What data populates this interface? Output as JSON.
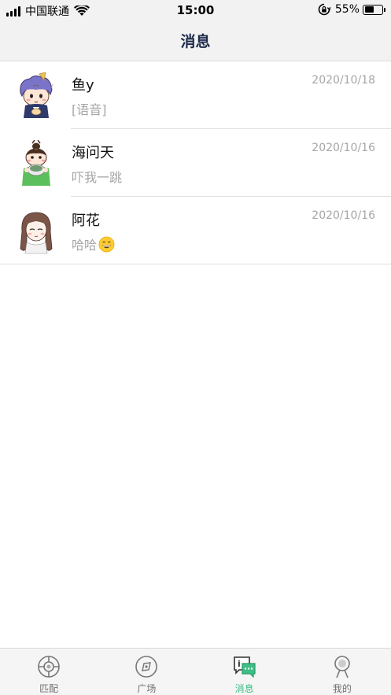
{
  "status_bar": {
    "carrier": "中国联通",
    "time": "15:00",
    "battery_percent": "55%",
    "battery_level": 0.55,
    "icons": [
      "signal-icon",
      "wifi-icon",
      "rotation-lock-icon",
      "battery-icon"
    ]
  },
  "header": {
    "title": "消息"
  },
  "conversations": [
    {
      "name": "鱼y",
      "date": "2020/10/18",
      "preview": "[语音]",
      "avatar": "purple-hair-boy-avatar"
    },
    {
      "name": "海问天",
      "date": "2020/10/16",
      "preview": "吓我一跳",
      "avatar": "bun-hair-girl-avatar"
    },
    {
      "name": "阿花",
      "date": "2020/10/16",
      "preview": "哈哈",
      "avatar": "long-hair-girl-avatar",
      "preview_emoji": "grinning-face-icon"
    }
  ],
  "tabs": [
    {
      "label": "匹配",
      "icon": "match-target-icon",
      "active": false
    },
    {
      "label": "广场",
      "icon": "compass-icon",
      "active": false
    },
    {
      "label": "消息",
      "icon": "chat-bubble-icon",
      "active": true
    },
    {
      "label": "我的",
      "icon": "profile-person-icon",
      "active": false
    }
  ],
  "colors": {
    "active_tab": "#3dbf86",
    "header_title": "#1d2b4a",
    "secondary_text": "#a6a6a6"
  }
}
